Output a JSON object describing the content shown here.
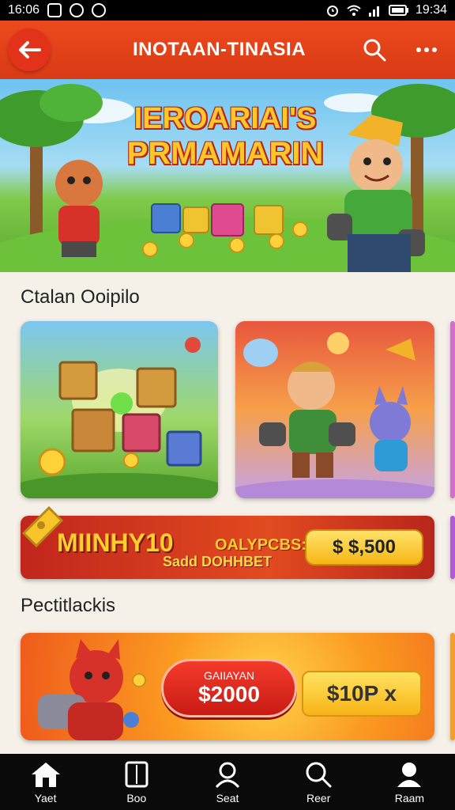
{
  "status_bar": {
    "time": "16:06",
    "clock": "19:34",
    "left_icons": [
      "notification-icon",
      "cat-icon",
      "chat-icon"
    ],
    "right_icons": [
      "alarm-icon",
      "wifi-icon",
      "signal-icon",
      "battery-icon"
    ]
  },
  "app_bar": {
    "title": "INOTAAN-TINASIA",
    "back_icon": "arrow-left-icon",
    "search_icon": "search-icon",
    "more_icon": "more-dots-icon",
    "color": "#e8431b"
  },
  "hero": {
    "title_line1": "IEROARIAI'S",
    "title_line2": "PRMAMARIN"
  },
  "sections": {
    "featured_heading": "Ctalan Ooipilo",
    "promo_heading": "Pectitlackis"
  },
  "promo1": {
    "title": "MIINHY10",
    "title2": "OALYPCBS:",
    "subtitle": "Sadd DOHHBET",
    "button": "$ $,500"
  },
  "promo2": {
    "button_small": "GAIIAYAN",
    "button_big": "$2000",
    "amount": "$10P x"
  },
  "bottom_nav": [
    {
      "label": "Yaet",
      "icon": "home-icon"
    },
    {
      "label": "Boo",
      "icon": "book-icon"
    },
    {
      "label": "Seat",
      "icon": "user-search-icon"
    },
    {
      "label": "Reer",
      "icon": "search-icon"
    },
    {
      "label": "Raam",
      "icon": "profile-icon"
    }
  ]
}
